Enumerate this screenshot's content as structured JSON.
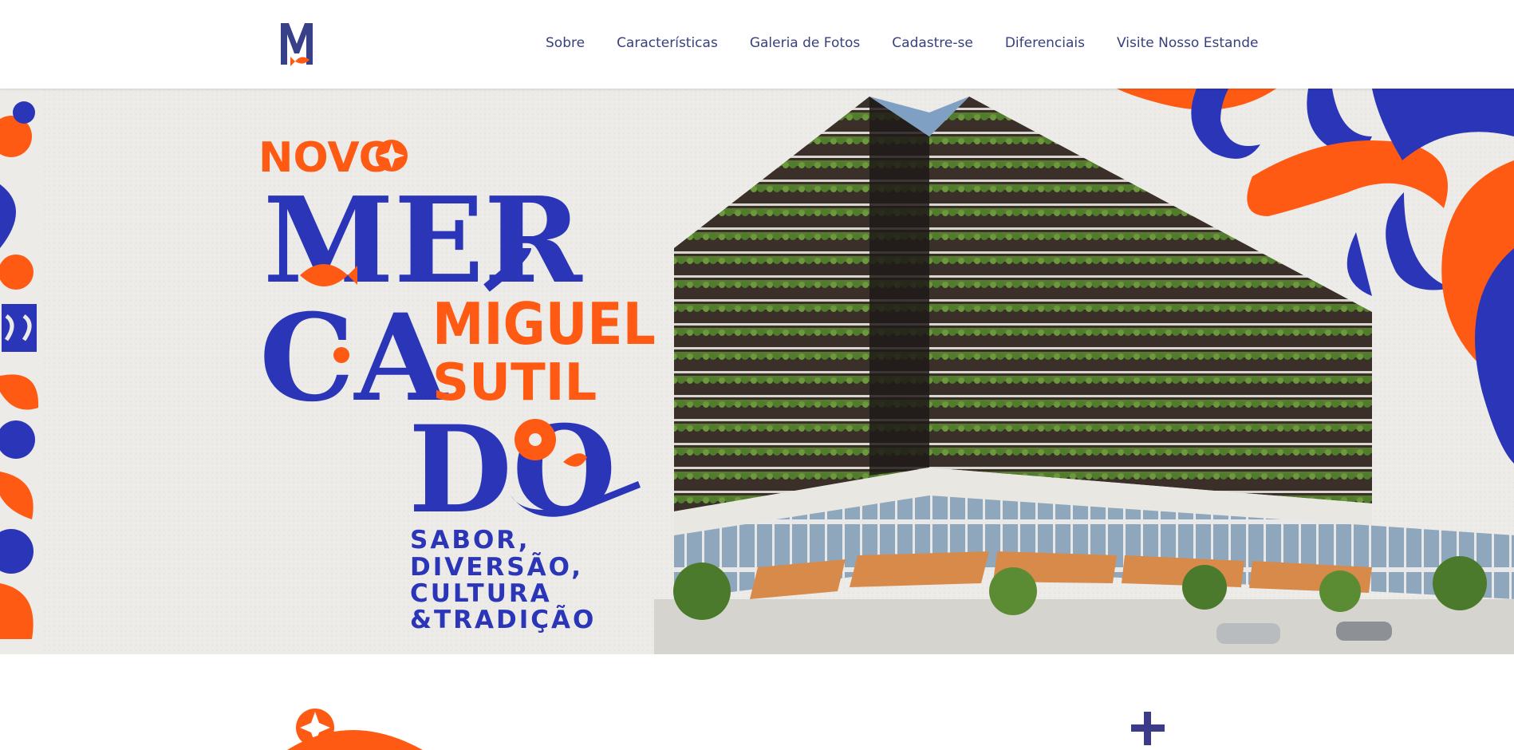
{
  "nav": {
    "items": [
      "Sobre",
      "Características",
      "Galeria de Fotos",
      "Cadastre-se",
      "Diferenciais",
      "Visite Nosso Estande"
    ]
  },
  "hero": {
    "novo": "NOVO",
    "mer": "MER",
    "ca": "CA",
    "do": "DO",
    "miguel": "MIGUEL",
    "sutil": "SUTIL",
    "tagline": [
      "SABOR,",
      "DIVERSÃO,",
      "CULTURA",
      "&TRADIÇÃO"
    ]
  },
  "icons": {
    "logo": "mercado-m-logo",
    "plus": "plus-icon",
    "star": "star-badge-icon"
  },
  "colors": {
    "brand_blue": "#2b35b8",
    "brand_orange": "#ff5a14",
    "nav_text": "#38407e",
    "paper": "#ecebe8"
  }
}
